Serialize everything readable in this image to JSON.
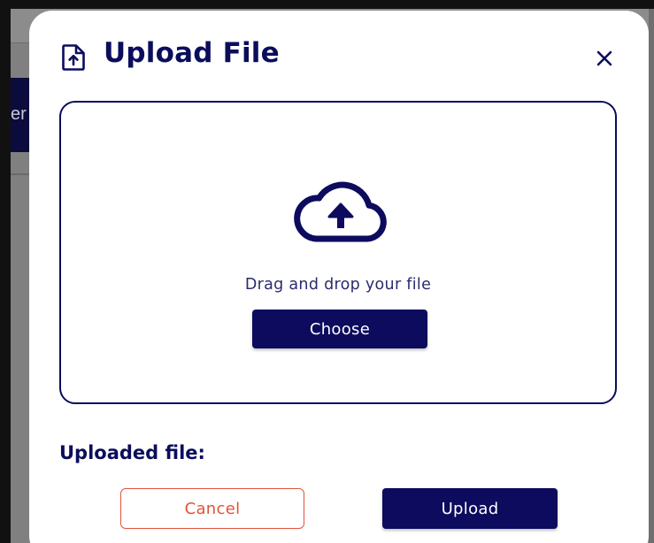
{
  "background": {
    "nav_text_fragment": "er"
  },
  "modal": {
    "title": "Upload File",
    "title_icon": "file-upload-icon",
    "close_icon": "close-icon",
    "dropzone": {
      "icon": "cloud-upload-icon",
      "instruction": "Drag and drop your file",
      "choose_label": "Choose"
    },
    "uploaded_label": "Uploaded file:",
    "cancel_label": "Cancel",
    "upload_label": "Upload"
  },
  "colors": {
    "primary": "#0c0b5e",
    "cancel": "#e0543d",
    "backdrop": "#808080",
    "nav_background": "#0c0b3d"
  }
}
